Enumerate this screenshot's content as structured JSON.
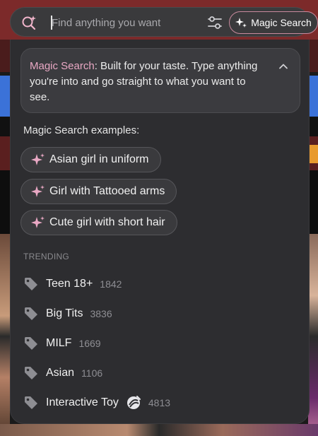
{
  "search": {
    "placeholder": "Find anything you want",
    "magic_button_label": "Magic Search"
  },
  "info": {
    "highlight": "Magic Search",
    "text": ": Built for your taste. Type anything you're into and go straight to what you want to see."
  },
  "examples": {
    "title": "Magic Search examples:",
    "items": [
      {
        "label": "Asian girl in uniform"
      },
      {
        "label": "Girl with Tattooed arms"
      },
      {
        "label": "Cute girl with short hair"
      }
    ]
  },
  "trending": {
    "title": "TRENDING",
    "items": [
      {
        "name": "Teen 18+",
        "count": "1842"
      },
      {
        "name": "Big Tits",
        "count": "3836"
      },
      {
        "name": "MILF",
        "count": "1669"
      },
      {
        "name": "Asian",
        "count": "1106"
      },
      {
        "name": "Interactive Toy",
        "count": "4813",
        "icon": "interactive-toy-icon"
      }
    ]
  },
  "colors": {
    "accent_pink": "#e9a8c4",
    "panel_bg": "#2d2d30",
    "chip_bg": "#3a3a3d",
    "muted_text": "#8e8e93"
  }
}
